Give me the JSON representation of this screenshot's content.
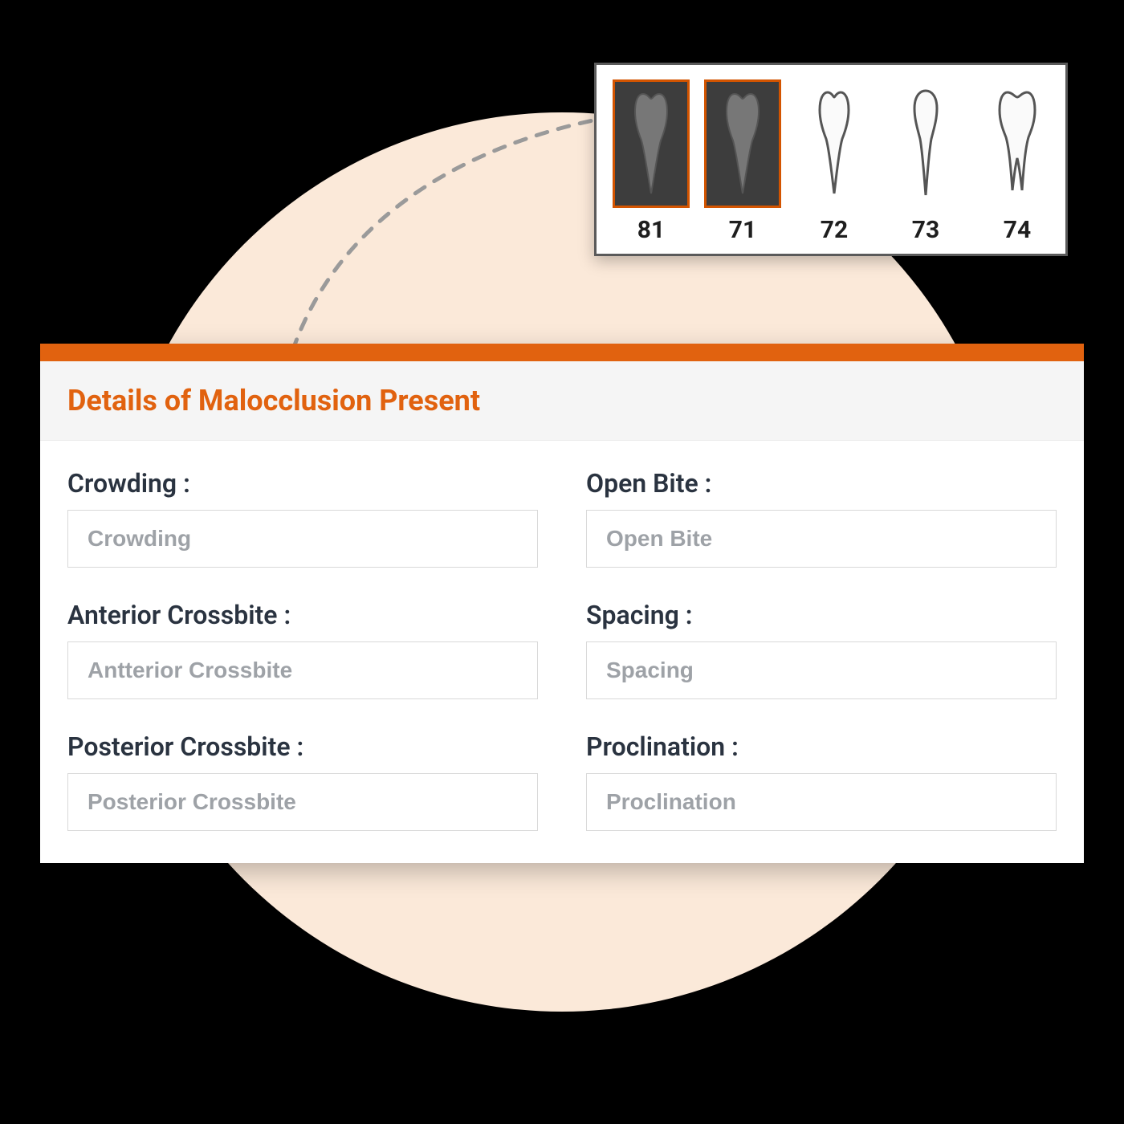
{
  "teeth": [
    {
      "number": "81",
      "selected": true
    },
    {
      "number": "71",
      "selected": true
    },
    {
      "number": "72",
      "selected": false
    },
    {
      "number": "73",
      "selected": false
    },
    {
      "number": "74",
      "selected": false
    }
  ],
  "details": {
    "title": "Details of Malocclusion Present",
    "fields": {
      "crowding": {
        "label": "Crowding :",
        "placeholder": "Crowding"
      },
      "open_bite": {
        "label": "Open Bite :",
        "placeholder": "Open Bite"
      },
      "anterior_crossbite": {
        "label": "Anterior Crossbite :",
        "placeholder": "Antterior Crossbite"
      },
      "spacing": {
        "label": "Spacing :",
        "placeholder": "Spacing"
      },
      "posterior_crossbite": {
        "label": "Posterior Crossbite :",
        "placeholder": "Posterior Crossbite"
      },
      "proclination": {
        "label": "Proclination :",
        "placeholder": "Proclination"
      }
    }
  }
}
